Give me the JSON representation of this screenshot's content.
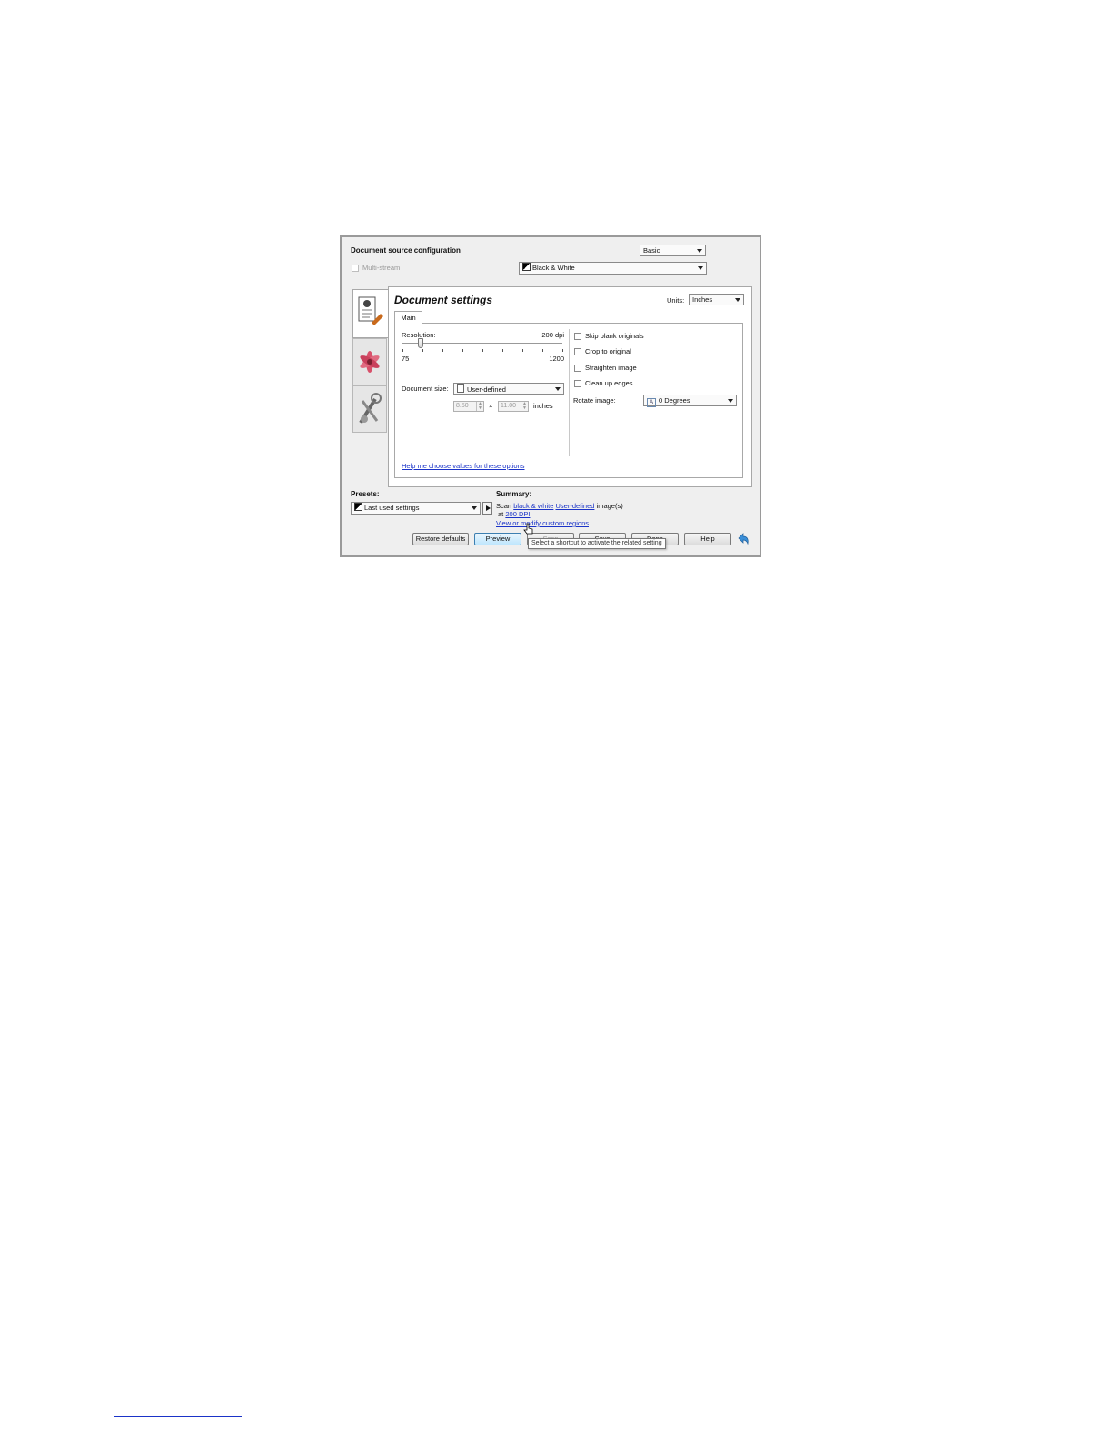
{
  "header": {
    "title": "Document source configuration",
    "mode_select": "Basic",
    "multistream_label": "Multi-stream",
    "color_mode_select": "Black & White"
  },
  "side_tabs": [
    {
      "icon": "document-settings-icon"
    },
    {
      "icon": "flower-image-icon"
    },
    {
      "icon": "tools-icon"
    }
  ],
  "panel": {
    "title": "Document settings",
    "units_label": "Units:",
    "units_value": "Inches",
    "tab_main": "Main"
  },
  "resolution": {
    "label": "Resolution:",
    "value_text": "200 dpi",
    "min_label": "75",
    "max_label": "1200",
    "value": 200,
    "min": 75,
    "max": 1200
  },
  "document_size": {
    "label": "Document size:",
    "value": "User-defined",
    "width": "8.50",
    "times": "×",
    "height": "11.00",
    "unit": "inches"
  },
  "options": {
    "skip_blank": "Skip blank originals",
    "crop": "Crop to original",
    "straighten": "Straighten image",
    "clean_edges": "Clean up edges",
    "rotate_label": "Rotate image:",
    "rotate_value": "0 Degrees"
  },
  "help_link": "Help me choose values for these options",
  "presets": {
    "label": "Presets:",
    "value": "Last used settings"
  },
  "summary": {
    "label": "Summary:",
    "scan": "Scan",
    "color_link": "black & white",
    "size_link": "User-defined",
    "images": "image(s)",
    "at": "at",
    "dpi_link": "200 DPI",
    "regions_link": "View or modify custom regions",
    "period": "."
  },
  "buttons": {
    "restore": "Restore defaults",
    "preview": "Preview",
    "scan": "Scan",
    "save": "Save",
    "done": "Done",
    "help": "Help"
  },
  "tooltip": "Select a shortcut to activate the related setting"
}
